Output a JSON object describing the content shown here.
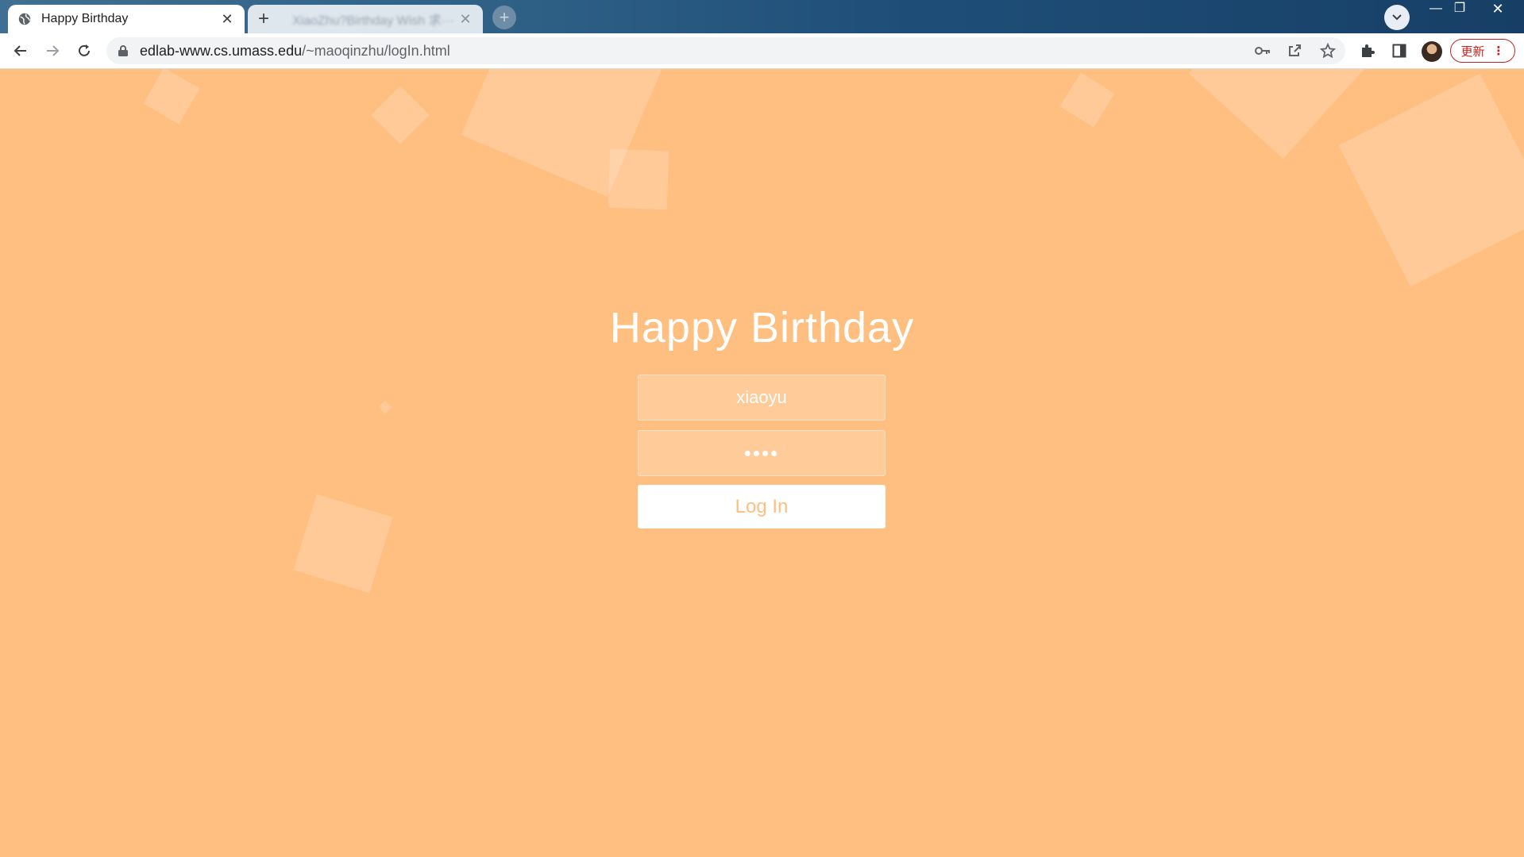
{
  "browser": {
    "tabs": [
      {
        "title": "Happy Birthday",
        "active": true
      },
      {
        "title": "XiaoZhu?Birthday Wish 求···",
        "active": false
      }
    ],
    "url_host": "edlab-www.cs.umass.edu",
    "url_path": "/~maoqinzhu/logIn.html",
    "update_label": "更新",
    "icons": [
      "globe-icon",
      "close-icon",
      "plus-icon",
      "chevron-down-icon",
      "minimize-icon",
      "maximize-icon",
      "window-close-icon",
      "back-arrow-icon",
      "forward-arrow-icon",
      "reload-icon",
      "lock-icon",
      "key-icon",
      "share-icon",
      "star-icon",
      "puzzle-icon",
      "side-panel-icon",
      "kebab-menu-icon"
    ]
  },
  "page": {
    "title": "Happy Birthday",
    "username_value": "xiaoyu",
    "password_value": "••••",
    "login_label": "Log In"
  },
  "colors": {
    "background": "#ffbf80",
    "button_text": "#ffbf80",
    "heading": "#ffffff"
  }
}
